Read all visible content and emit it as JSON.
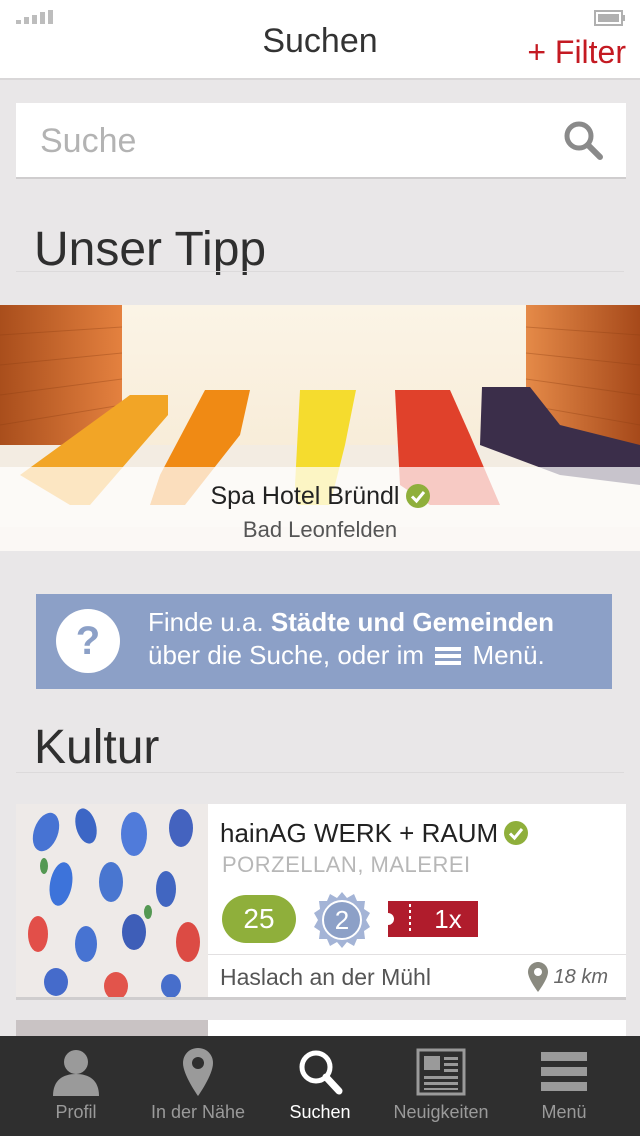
{
  "header": {
    "title": "Suchen",
    "filter_label": "+ Filter"
  },
  "search": {
    "placeholder": "Suche"
  },
  "tip": {
    "heading": "Unser Tipp",
    "name": "Spa Hotel Bründl",
    "city": "Bad Leonfelden"
  },
  "info": {
    "line1_prefix": "Finde u.a. ",
    "line1_bold": "Städte und Gemeinden",
    "line2_prefix": "über die Suche, oder im",
    "line2_suffix": "Menü."
  },
  "kultur": {
    "heading": "Kultur",
    "card": {
      "title": "hainAG  WERK + RAUM",
      "category": "PORZELLAN, MALEREI",
      "badge_points": "25",
      "badge_rosette": "2",
      "badge_ticket": "1x",
      "place": "Haslach an der Mühl",
      "distance": "18 km"
    }
  },
  "tabs": [
    {
      "label": "Profil",
      "icon": "person-icon"
    },
    {
      "label": "In der Nähe",
      "icon": "location-pin-icon"
    },
    {
      "label": "Suchen",
      "icon": "search-icon"
    },
    {
      "label": "Neuigkeiten",
      "icon": "newspaper-icon"
    },
    {
      "label": "Menü",
      "icon": "menu-icon"
    }
  ],
  "colors": {
    "accent_red": "#c41a22",
    "verified_green": "#8faf3b",
    "info_blue": "#8ca0c7",
    "tabbar": "#2f2f2f"
  }
}
